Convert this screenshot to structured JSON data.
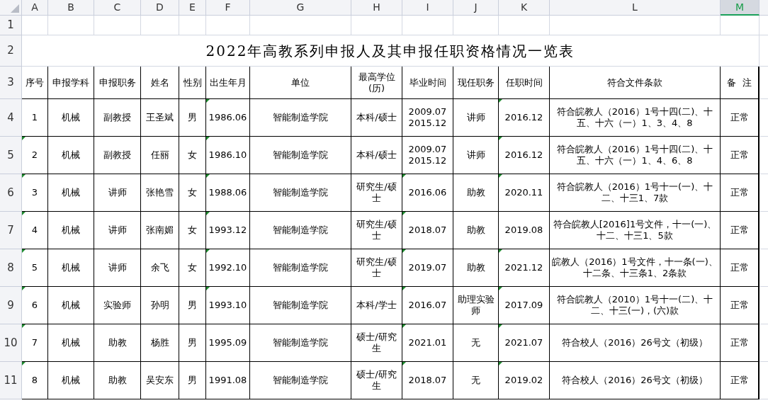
{
  "column_headers": [
    {
      "label": "A",
      "selected": false
    },
    {
      "label": "B",
      "selected": false
    },
    {
      "label": "C",
      "selected": false
    },
    {
      "label": "D",
      "selected": false
    },
    {
      "label": "E",
      "selected": false
    },
    {
      "label": "F",
      "selected": false
    },
    {
      "label": "G",
      "selected": false
    },
    {
      "label": "H",
      "selected": false
    },
    {
      "label": "I",
      "selected": false
    },
    {
      "label": "J",
      "selected": false
    },
    {
      "label": "K",
      "selected": false
    },
    {
      "label": "L",
      "selected": false
    },
    {
      "label": "M",
      "selected": true
    }
  ],
  "row_numbers": [
    "1",
    "2",
    "3",
    "4",
    "5",
    "6",
    "7",
    "8",
    "9",
    "10",
    "11"
  ],
  "title": "2022年高教系列申报人及其申报任职资格情况一览表",
  "table_header": [
    "序号",
    "申报学科",
    "申报职务",
    "姓名",
    "性别",
    "出生年月",
    "单位",
    "最高学位(历)",
    "毕业时间",
    "现任职务",
    "任职时间",
    "符合文件条款",
    "备  注"
  ],
  "rows": [
    {
      "cells": [
        {
          "text": "1",
          "flagged": false
        },
        {
          "text": "机械",
          "flagged": false
        },
        {
          "text": "副教授",
          "flagged": false
        },
        {
          "text": "王圣斌",
          "flagged": false
        },
        {
          "text": "男",
          "flagged": false
        },
        {
          "text": "1986.06",
          "flagged": true
        },
        {
          "text": "智能制造学院",
          "flagged": false
        },
        {
          "text": "本科/硕士",
          "flagged": false
        },
        {
          "text": "2009.07\n2015.12",
          "flagged": false
        },
        {
          "text": "讲师",
          "flagged": false
        },
        {
          "text": "2016.12",
          "flagged": true
        },
        {
          "text": "符合皖教人（2016）1号十四(二)、十五、十六（一）1、3、4、8",
          "flagged": false
        },
        {
          "text": "正常",
          "flagged": false
        }
      ]
    },
    {
      "cells": [
        {
          "text": "2",
          "flagged": true
        },
        {
          "text": "机械",
          "flagged": false
        },
        {
          "text": "副教授",
          "flagged": false
        },
        {
          "text": "任丽",
          "flagged": false
        },
        {
          "text": "女",
          "flagged": false
        },
        {
          "text": "1986.10",
          "flagged": true
        },
        {
          "text": "智能制造学院",
          "flagged": false
        },
        {
          "text": "本科/硕士",
          "flagged": false
        },
        {
          "text": "2009.07\n2015.12",
          "flagged": false
        },
        {
          "text": "讲师",
          "flagged": false
        },
        {
          "text": "2016.12",
          "flagged": true
        },
        {
          "text": "符合皖教人（2016）1号十四(二)、十五、十六（一）1、4、6、8",
          "flagged": false
        },
        {
          "text": "正常",
          "flagged": false
        }
      ]
    },
    {
      "cells": [
        {
          "text": "3",
          "flagged": true
        },
        {
          "text": "机械",
          "flagged": false
        },
        {
          "text": "讲师",
          "flagged": false
        },
        {
          "text": "张艳雪",
          "flagged": false
        },
        {
          "text": "女",
          "flagged": false
        },
        {
          "text": "1988.06",
          "flagged": true
        },
        {
          "text": "智能制造学院",
          "flagged": false
        },
        {
          "text": "研究生/硕士",
          "flagged": false
        },
        {
          "text": "2016.06",
          "flagged": true
        },
        {
          "text": "助教",
          "flagged": false
        },
        {
          "text": "2020.11",
          "flagged": true
        },
        {
          "text": "符合皖教人（2016）1号十一(一)、十二、十三1、7款",
          "flagged": false
        },
        {
          "text": "正常",
          "flagged": false
        }
      ]
    },
    {
      "cells": [
        {
          "text": "4",
          "flagged": true
        },
        {
          "text": "机械",
          "flagged": false
        },
        {
          "text": "讲师",
          "flagged": false
        },
        {
          "text": "张南媚",
          "flagged": false
        },
        {
          "text": "女",
          "flagged": false
        },
        {
          "text": "1993.12",
          "flagged": true
        },
        {
          "text": "智能制造学院",
          "flagged": false
        },
        {
          "text": "研究生/硕士",
          "flagged": false
        },
        {
          "text": "2018.07",
          "flagged": true
        },
        {
          "text": "助教",
          "flagged": false
        },
        {
          "text": "2019.08",
          "flagged": false
        },
        {
          "text": "符合皖教人[2016]1号文件，十一(一)、十二、十三1、5款",
          "flagged": false
        },
        {
          "text": "正常",
          "flagged": false
        }
      ]
    },
    {
      "cells": [
        {
          "text": "5",
          "flagged": true
        },
        {
          "text": "机械",
          "flagged": false
        },
        {
          "text": "讲师",
          "flagged": false
        },
        {
          "text": "余飞",
          "flagged": false
        },
        {
          "text": "女",
          "flagged": false
        },
        {
          "text": "1992.10",
          "flagged": true
        },
        {
          "text": "智能制造学院",
          "flagged": false
        },
        {
          "text": "研究生/硕士",
          "flagged": false
        },
        {
          "text": "2019.07",
          "flagged": true
        },
        {
          "text": "助教",
          "flagged": false
        },
        {
          "text": "2021.12",
          "flagged": true
        },
        {
          "text": "皖教人（2016）1号文件，十一条(一)、十二条、十三条1、2条款",
          "flagged": false
        },
        {
          "text": "正常",
          "flagged": false
        }
      ]
    },
    {
      "cells": [
        {
          "text": "6",
          "flagged": true
        },
        {
          "text": "机械",
          "flagged": false
        },
        {
          "text": "实验师",
          "flagged": false
        },
        {
          "text": "孙明",
          "flagged": false
        },
        {
          "text": "男",
          "flagged": false
        },
        {
          "text": "1993.10",
          "flagged": true
        },
        {
          "text": "智能制造学院",
          "flagged": false
        },
        {
          "text": "本科/学士",
          "flagged": false
        },
        {
          "text": "2016.07",
          "flagged": true
        },
        {
          "text": "助理实验师",
          "flagged": false
        },
        {
          "text": "2017.09",
          "flagged": true
        },
        {
          "text": "符合皖教人（2010）1号十一(二)、十二、十三(一)，(六)款",
          "flagged": false
        },
        {
          "text": "正常",
          "flagged": false
        }
      ]
    },
    {
      "cells": [
        {
          "text": "7",
          "flagged": true
        },
        {
          "text": "机械",
          "flagged": false
        },
        {
          "text": "助教",
          "flagged": false
        },
        {
          "text": "杨胜",
          "flagged": false
        },
        {
          "text": "男",
          "flagged": false
        },
        {
          "text": "1995.09",
          "flagged": false
        },
        {
          "text": "智能制造学院",
          "flagged": false
        },
        {
          "text": "硕士/研究生",
          "flagged": false
        },
        {
          "text": "2021.01",
          "flagged": true
        },
        {
          "text": "无",
          "flagged": false
        },
        {
          "text": "2021.07",
          "flagged": true
        },
        {
          "text": "符合校人（2016）26号文（初级）",
          "flagged": false
        },
        {
          "text": "正常",
          "flagged": false
        }
      ]
    },
    {
      "cells": [
        {
          "text": "8",
          "flagged": true
        },
        {
          "text": "机械",
          "flagged": false
        },
        {
          "text": "助教",
          "flagged": false
        },
        {
          "text": "吴安东",
          "flagged": false
        },
        {
          "text": "男",
          "flagged": false
        },
        {
          "text": "1991.08",
          "flagged": false
        },
        {
          "text": "智能制造学院",
          "flagged": false
        },
        {
          "text": "硕士/研究生",
          "flagged": false
        },
        {
          "text": "2018.07",
          "flagged": true
        },
        {
          "text": "无",
          "flagged": false
        },
        {
          "text": "2019.02",
          "flagged": true
        },
        {
          "text": "符合校人（2016）26号文（初级）",
          "flagged": false
        },
        {
          "text": "正常",
          "flagged": false
        }
      ]
    }
  ]
}
